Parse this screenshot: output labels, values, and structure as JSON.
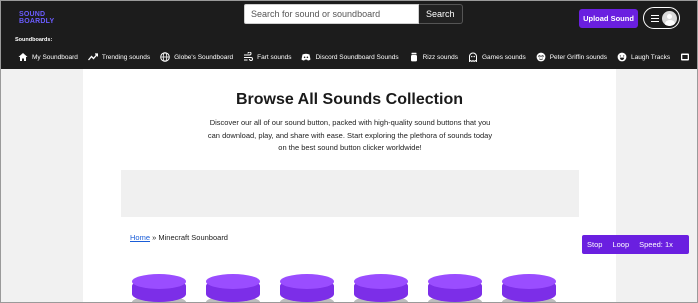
{
  "header": {
    "logo_line1": "SOUND",
    "logo_line2": "BOARDLY",
    "search_placeholder": "Search for sound or soundboard",
    "search_button": "Search",
    "upload_button": "Upload Sound"
  },
  "nav": {
    "caption": "Soundboards:",
    "items": [
      {
        "label": "My Soundboard",
        "icon": "home-icon"
      },
      {
        "label": "Trending sounds",
        "icon": "trending-icon"
      },
      {
        "label": "Globe's Soundboard",
        "icon": "globe-icon"
      },
      {
        "label": "Fart sounds",
        "icon": "wind-icon"
      },
      {
        "label": "Discord Soundboard Sounds",
        "icon": "discord-icon"
      },
      {
        "label": "Rizz sounds",
        "icon": "jar-icon"
      },
      {
        "label": "Games sounds",
        "icon": "ghost-icon"
      },
      {
        "label": "Peter Griffin sounds",
        "icon": "face-icon"
      },
      {
        "label": "Laugh Tracks",
        "icon": "laugh-icon"
      }
    ]
  },
  "main": {
    "title": "Browse All Sounds Collection",
    "description": "Discover our all of our sound button, packed with high-quality sound buttons that you can download, play, and share with ease. Start exploring the plethora of sounds today on the best sound button clicker worldwide!",
    "breadcrumb": {
      "home": "Home",
      "separator": " » ",
      "current": "Minecraft Sounboard"
    }
  },
  "player": {
    "stop": "Stop",
    "loop": "Loop",
    "speed": "Speed: 1x"
  },
  "colors": {
    "accent": "#6a1fe0",
    "header_bg": "#1c1c1c",
    "sound_button": "#9a4dff"
  }
}
